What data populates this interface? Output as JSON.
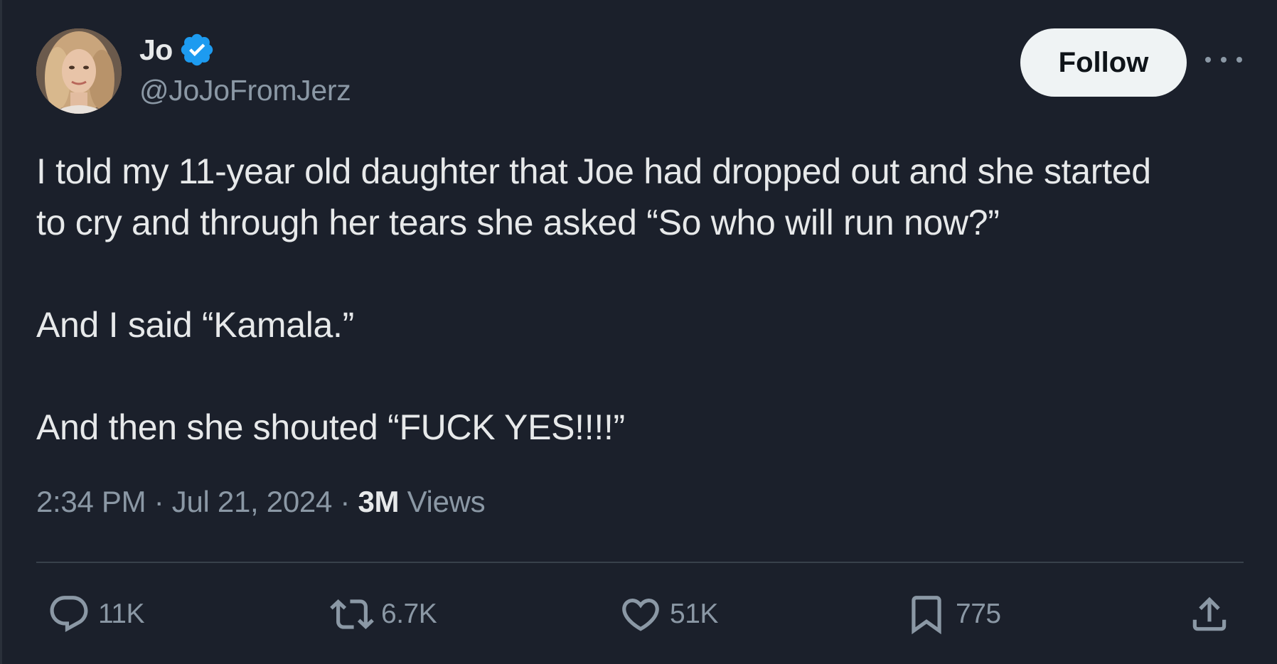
{
  "author": {
    "display_name": "Jo",
    "handle": "@JoJoFromJerz",
    "verified": true
  },
  "follow_label": "Follow",
  "tweet": {
    "lines": [
      "I told my 11-year old daughter that Joe had dropped out and she started",
      "to cry and through her tears she asked “So who will run now?”",
      "And I said “Kamala.”",
      "And then she shouted “FUCK YES!!!!”"
    ]
  },
  "meta": {
    "time": "2:34 PM",
    "separator": "·",
    "date": "Jul 21, 2024",
    "views_count": "3M",
    "views_label": "Views"
  },
  "actions": {
    "replies": "11K",
    "reposts": "6.7K",
    "likes": "51K",
    "bookmarks": "775"
  },
  "colors": {
    "background": "#1b202b",
    "text": "#e7e9ea",
    "secondary": "#8b98a5",
    "verified": "#1d9bf0",
    "follow_bg": "#eff3f4"
  }
}
